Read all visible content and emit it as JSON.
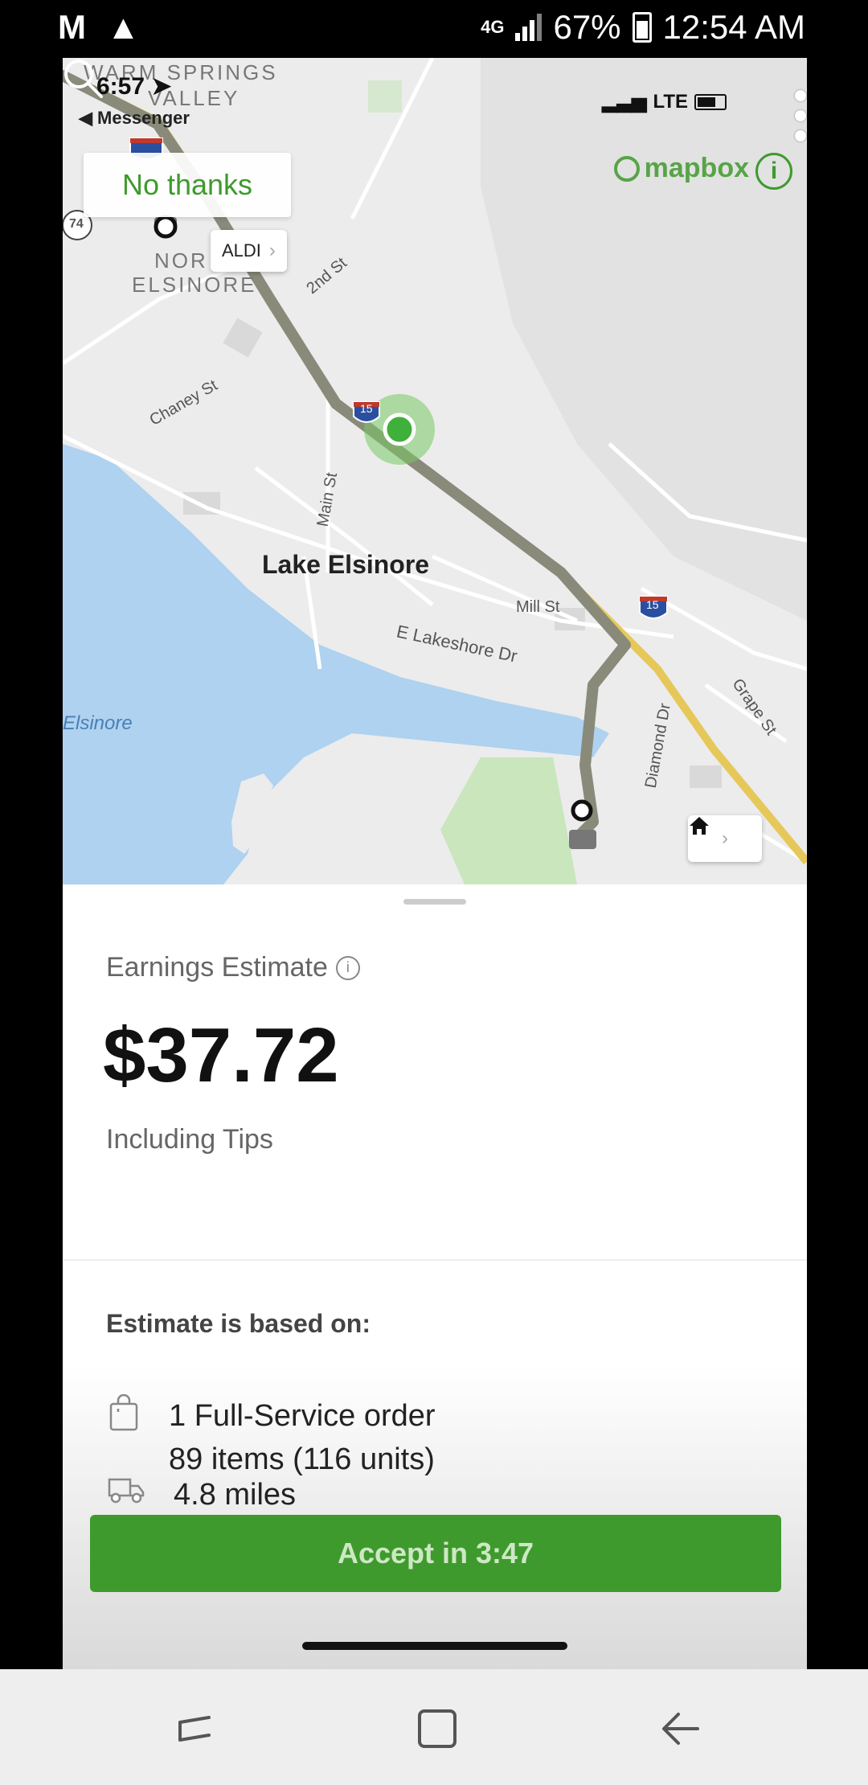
{
  "system_status": {
    "carrier_icon": "M",
    "warning_icon": "warning-triangle",
    "network": "4G",
    "battery": "67%",
    "time": "12:54 AM"
  },
  "inner_status": {
    "time": "6:57",
    "back_app": "◀ Messenger",
    "network": "LTE"
  },
  "map": {
    "no_thanks": "No thanks",
    "mapbox": "mapbox",
    "aldi_chip": "ALDI",
    "labels": {
      "area_warm_springs": "WARM SPRINGS",
      "area_valley": "VALLEY",
      "area_north": "NOR",
      "area_elsinore": "ELSINORE",
      "second_st": "2nd St",
      "chaney_st": "Chaney St",
      "main_st": "Main St",
      "lake_elsinore": "Lake Elsinore",
      "mill_st": "Mill St",
      "e_lakeshore": "E Lakeshore Dr",
      "grape_st": "Grape St",
      "diamond_dr": "Diamond Dr",
      "elsinore_lake": "Elsinore",
      "route_74": "74",
      "interstate_15": "15"
    }
  },
  "sheet": {
    "earnings_label": "Earnings Estimate",
    "amount": "$37.72",
    "including": "Including Tips",
    "based_on": "Estimate is based on:",
    "order_line1": "1 Full-Service order",
    "order_line2": "89 items (116 units)",
    "miles": "4.8 miles",
    "accept": "Accept in 3:47"
  },
  "colors": {
    "brand_green": "#3f9a2d",
    "route_gray": "#8a8a7a",
    "highway_yellow": "#e6c85a",
    "water_blue": "#aed2f0"
  }
}
